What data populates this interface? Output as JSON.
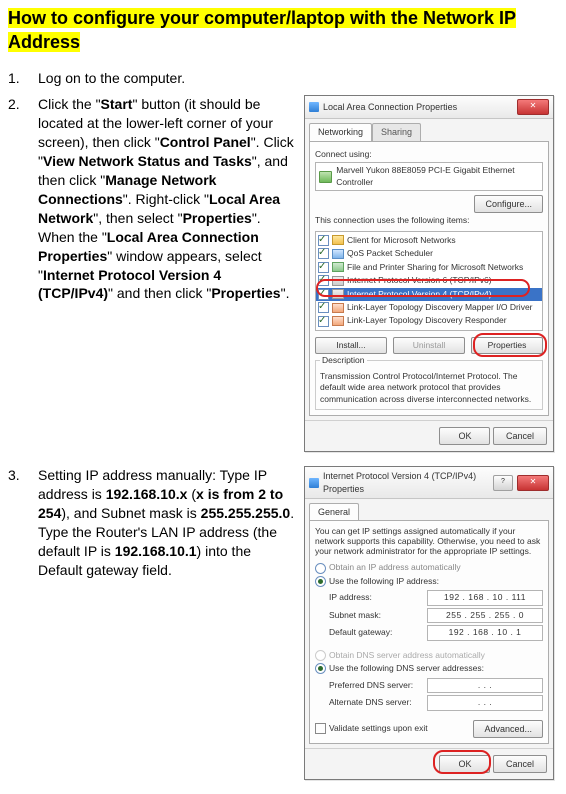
{
  "title": "How to configure your computer/laptop with the Network IP Address",
  "steps": {
    "s1": {
      "num": "1.",
      "text": "Log on to the computer."
    },
    "s2": {
      "num": "2.",
      "pre1": "Click the \"",
      "b1": "Start",
      "mid1": "\" button (it should be located at the lower-left corner of your screen), then click \"",
      "b2": "Control Panel",
      "mid2": "\". Click \"",
      "b3": "View Network Status and Tasks",
      "mid3": "\", and then click \"",
      "b4": "Manage Network Connections",
      "mid4": "\". Right-click \"",
      "b5": "Local Area Network",
      "mid5": "\", then select \"",
      "b6": "Properties",
      "mid6": "\". When the \"",
      "b7": "Local Area Connection Properties",
      "mid7": "\" window appears, select \"",
      "b8": "Internet Protocol Version 4 (TCP/IPv4)",
      "mid8": "\" and then click \"",
      "b9": "Properties",
      "mid9": "\"."
    },
    "s3": {
      "num": "3.",
      "pre1": "Setting IP address manually: Type IP address is ",
      "b1": "192.168.10.x",
      "mid1": " (",
      "b2": "x is from 2 to 254",
      "mid2": "), and Subnet mask is ",
      "b3": "255.255.255.0",
      "mid3": ". Type the Router's LAN IP address (the default IP is ",
      "b4": "192.168.10.1",
      "mid4": ") into the Default gateway field."
    }
  },
  "dlg1": {
    "title": "Local Area Connection Properties",
    "tab1": "Networking",
    "tab2": "Sharing",
    "connect_using": "Connect using:",
    "nic": "Marvell Yukon 88E8059 PCI-E Gigabit Ethernet Controller",
    "configure": "Configure...",
    "uses_items": "This connection uses the following items:",
    "items": [
      "Client for Microsoft Networks",
      "QoS Packet Scheduler",
      "File and Printer Sharing for Microsoft Networks",
      "Internet Protocol Version 6 (TCP/IPv6)",
      "Internet Protocol Version 4 (TCP/IPv4)",
      "Link-Layer Topology Discovery Mapper I/O Driver",
      "Link-Layer Topology Discovery Responder"
    ],
    "install": "Install...",
    "uninstall": "Uninstall",
    "properties": "Properties",
    "desc_label": "Description",
    "desc": "Transmission Control Protocol/Internet Protocol. The default wide area network protocol that provides communication across diverse interconnected networks.",
    "ok": "OK",
    "cancel": "Cancel"
  },
  "dlg2": {
    "title": "Internet Protocol Version 4 (TCP/IPv4) Properties",
    "tab": "General",
    "intro": "You can get IP settings assigned automatically if your network supports this capability. Otherwise, you need to ask your network administrator for the appropriate IP settings.",
    "r_auto_ip": "Obtain an IP address automatically",
    "r_man_ip": "Use the following IP address:",
    "ip_label": "IP address:",
    "ip_val": "192 . 168 . 10 . 111",
    "sm_label": "Subnet mask:",
    "sm_val": "255 . 255 . 255 .  0",
    "gw_label": "Default gateway:",
    "gw_val": "192 . 168 . 10 .  1",
    "r_auto_dns": "Obtain DNS server address automatically",
    "r_man_dns": "Use the following DNS server addresses:",
    "pdns_label": "Preferred DNS server:",
    "pdns_val": ".      .      .",
    "adns_label": "Alternate DNS server:",
    "adns_val": ".      .      .",
    "validate": "Validate settings upon exit",
    "advanced": "Advanced...",
    "ok": "OK",
    "cancel": "Cancel"
  }
}
